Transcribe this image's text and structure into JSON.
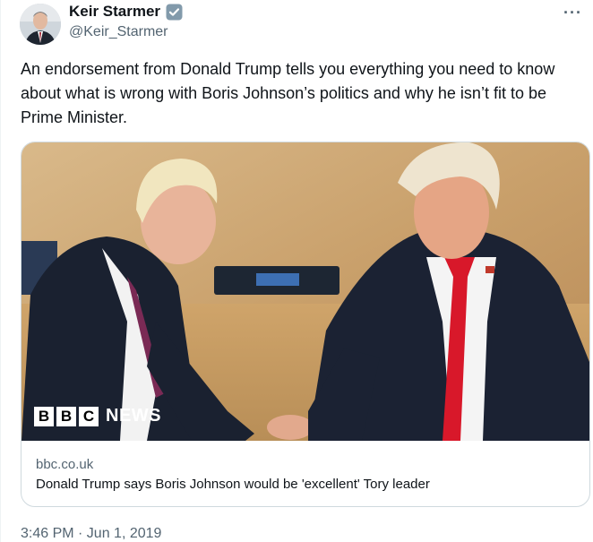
{
  "author": {
    "display_name": "Keir Starmer",
    "handle": "@Keir_Starmer",
    "avatar_icon": "person-avatar",
    "verified_icon": "verified-badge-icon",
    "verified_color": "#829aab"
  },
  "more_icon": "more-options-icon",
  "more_label": "···",
  "tweet_text": "An endorsement from Donald Trump tells you everything you need to know about what is wrong with Boris Johnson’s politics and why he isn’t fit to be Prime Minister.",
  "link_card": {
    "image_logo_letters": [
      "B",
      "B",
      "C"
    ],
    "image_logo_word": "NEWS",
    "domain": "bbc.co.uk",
    "title": "Donald Trump says Boris Johnson would be 'excellent' Tory leader"
  },
  "timestamp": "3:46 PM · Jun 1, 2019"
}
